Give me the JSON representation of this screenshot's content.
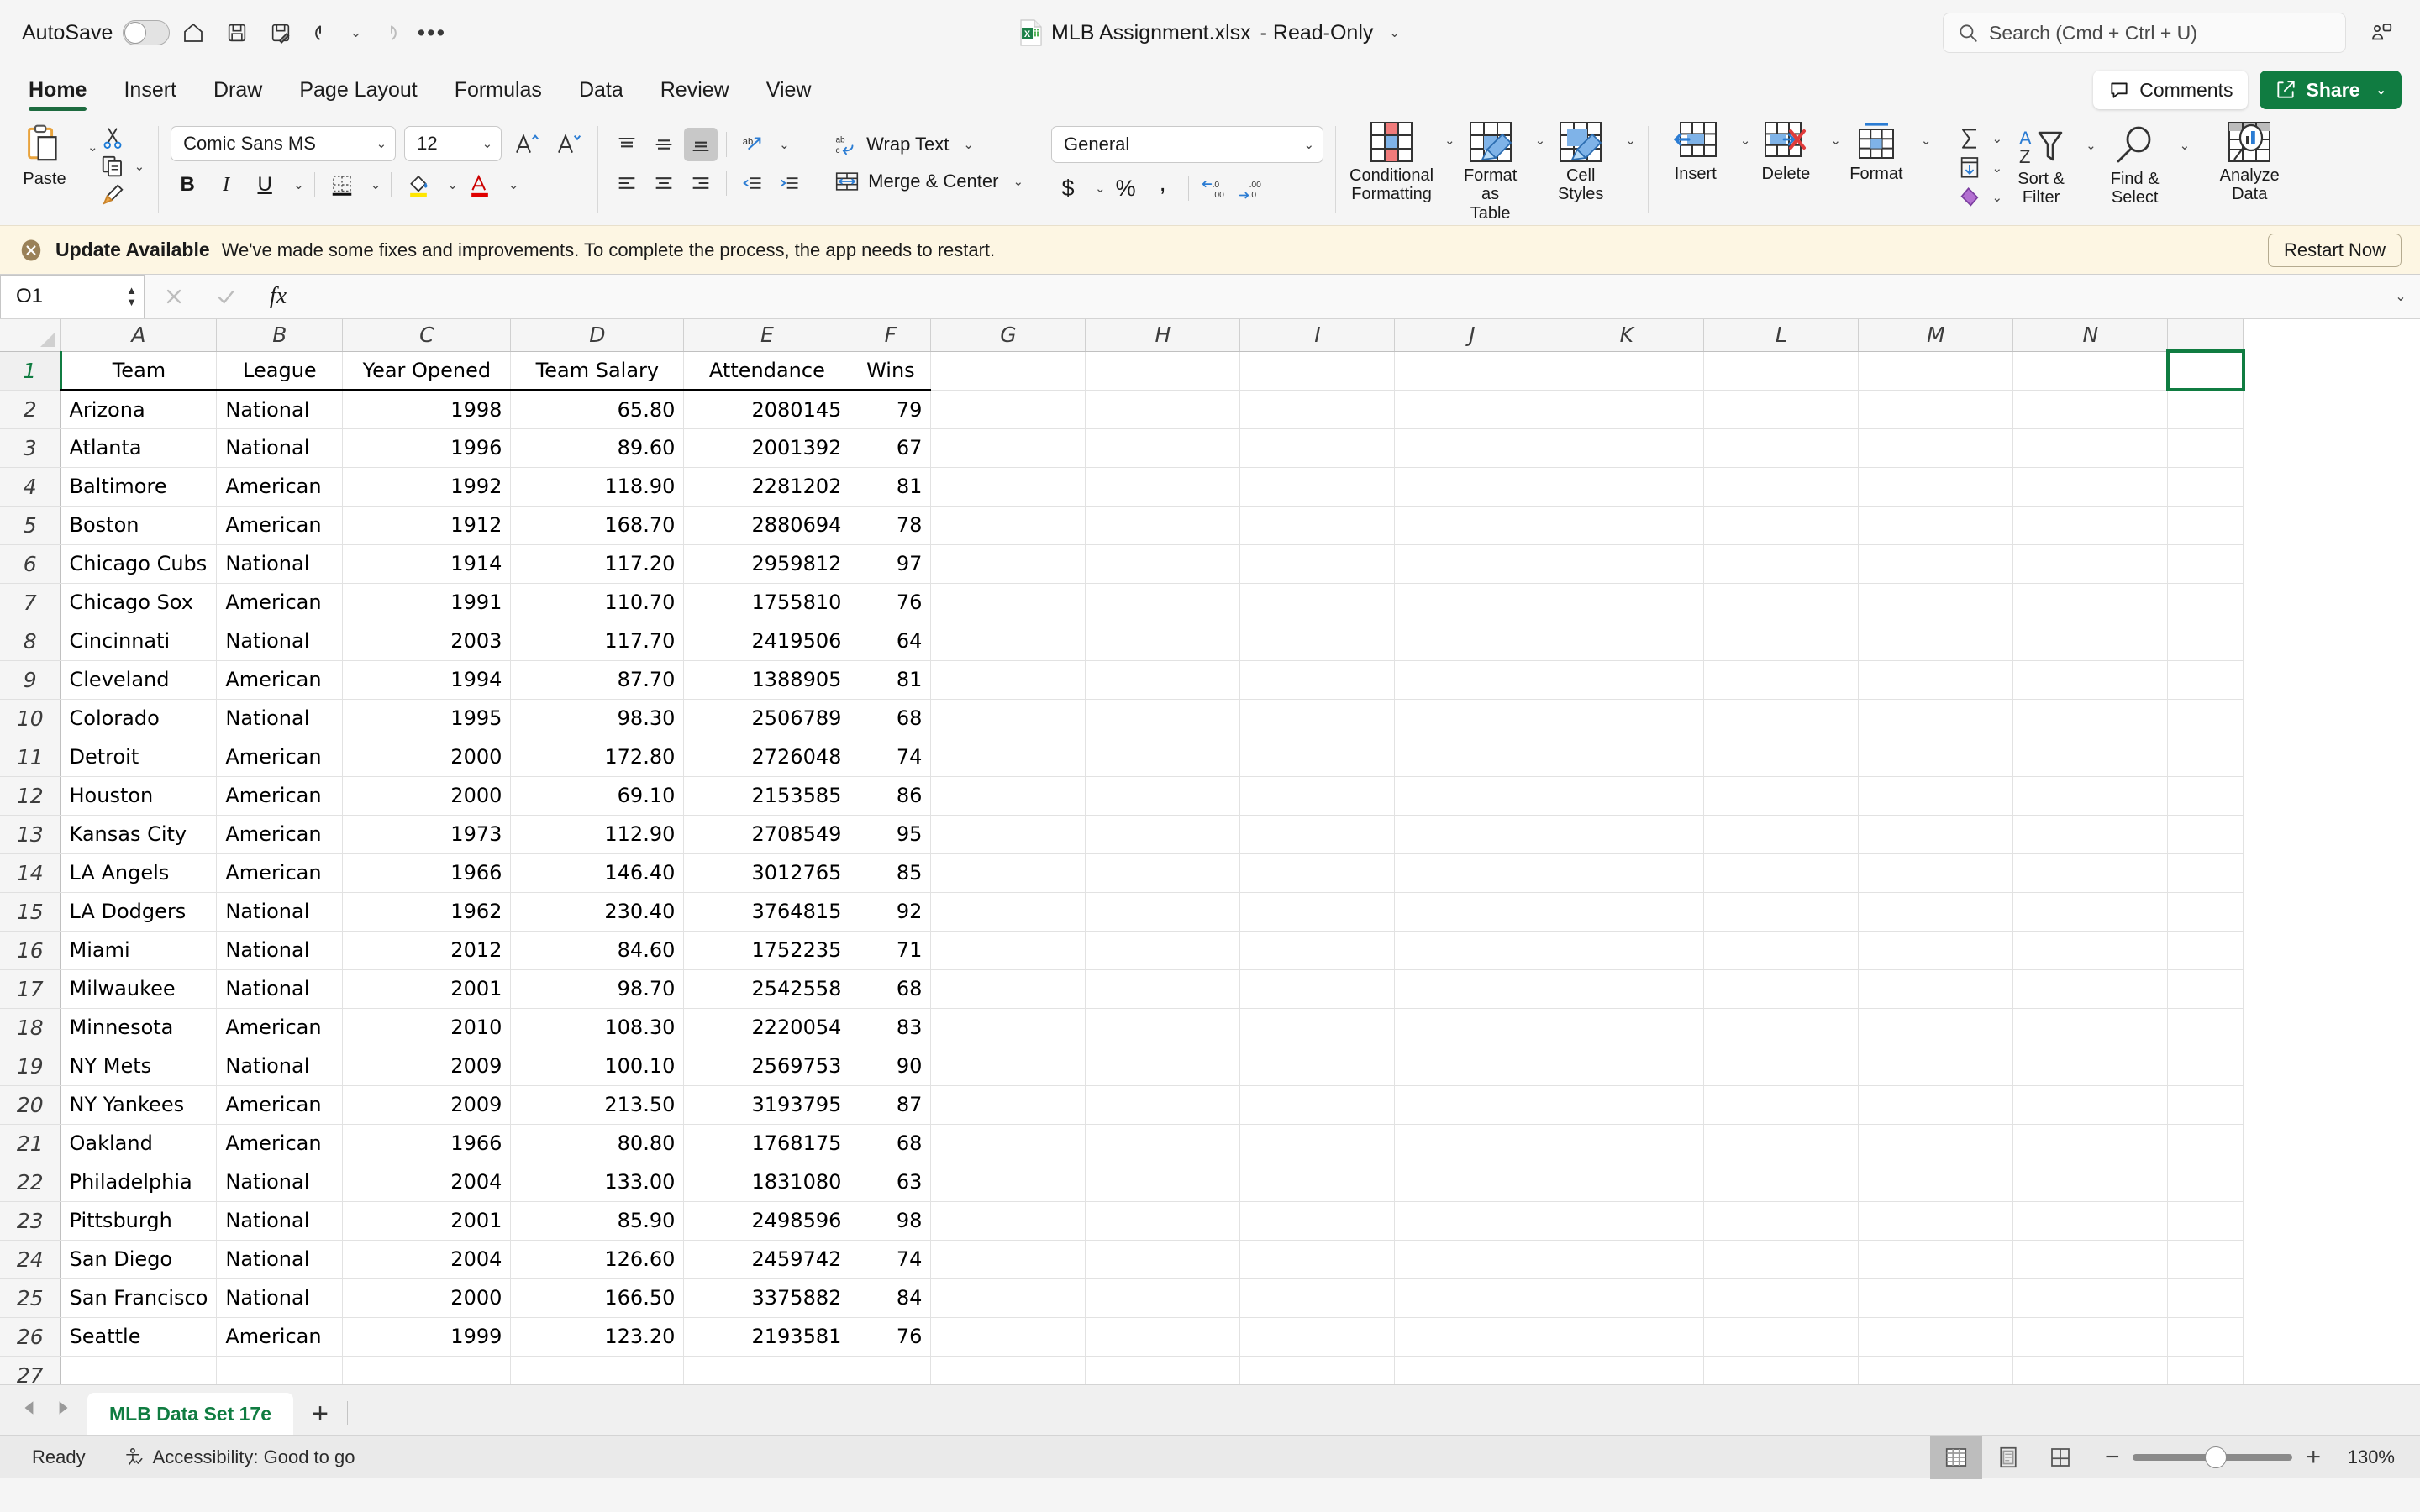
{
  "titlebar": {
    "autosave_label": "AutoSave",
    "document_name": "MLB Assignment.xlsx",
    "document_state": "-  Read-Only",
    "search_placeholder": "Search (Cmd + Ctrl + U)",
    "icons": {
      "home": "home-icon",
      "save": "save-icon",
      "save_as": "save-as-icon",
      "undo": "undo-icon",
      "redo": "redo-icon",
      "more": "more-options-icon",
      "ribbon_display": "ribbon-display-options-icon"
    }
  },
  "ribbon": {
    "tabs": [
      {
        "label": "Home",
        "active": true
      },
      {
        "label": "Insert",
        "active": false
      },
      {
        "label": "Draw",
        "active": false
      },
      {
        "label": "Page Layout",
        "active": false
      },
      {
        "label": "Formulas",
        "active": false
      },
      {
        "label": "Data",
        "active": false
      },
      {
        "label": "Review",
        "active": false
      },
      {
        "label": "View",
        "active": false
      }
    ],
    "comments_label": "Comments",
    "share_label": "Share",
    "clipboard": {
      "paste_label": "Paste",
      "cut": "cut-icon",
      "copy": "copy-icon",
      "format_painter": "format-painter-icon"
    },
    "font": {
      "family": "Comic Sans MS",
      "size": "12",
      "grow": "A",
      "shrink": "A",
      "bold": "B",
      "italic": "I",
      "underline": "U"
    },
    "alignment": {
      "wrap_text": "Wrap Text",
      "merge_center": "Merge & Center"
    },
    "number": {
      "format": "General",
      "currency": "$",
      "percent": "%",
      "comma": ",",
      "increase_decimal": ".00",
      "decrease_decimal": ".00"
    },
    "styles": [
      {
        "label_line1": "Conditional",
        "label_line2": "Formatting"
      },
      {
        "label_line1": "Format",
        "label_line2": "as Table"
      },
      {
        "label_line1": "Cell",
        "label_line2": "Styles"
      }
    ],
    "cells": [
      {
        "label": "Insert"
      },
      {
        "label": "Delete"
      },
      {
        "label": "Format"
      }
    ],
    "editing": [
      {
        "label_line1": "Sort &",
        "label_line2": "Filter"
      },
      {
        "label_line1": "Find &",
        "label_line2": "Select"
      }
    ],
    "analyze": {
      "label_line1": "Analyze",
      "label_line2": "Data"
    }
  },
  "banner": {
    "title": "Update Available",
    "message": "We've made some fixes and improvements. To complete the process, the app needs to restart.",
    "button": "Restart Now",
    "icon": "close-circle-icon"
  },
  "formula_bar": {
    "name_box": "O1",
    "cancel_icon": "cancel-icon",
    "confirm_icon": "confirm-icon",
    "function_icon": "fx",
    "value": ""
  },
  "sheet": {
    "columns": [
      "A",
      "B",
      "C",
      "D",
      "E",
      "F",
      "G",
      "H",
      "I",
      "J",
      "K",
      "L",
      "M",
      "N"
    ],
    "headers": [
      "Team",
      "League",
      "Year Opened",
      "Team Salary",
      "Attendance",
      "Wins"
    ],
    "selected_cell": "O1",
    "rows": [
      {
        "n": "2",
        "team": "Arizona",
        "league": "National",
        "year": "1998",
        "salary": "65.80",
        "attendance": "2080145",
        "wins": "79"
      },
      {
        "n": "3",
        "team": "Atlanta",
        "league": "National",
        "year": "1996",
        "salary": "89.60",
        "attendance": "2001392",
        "wins": "67"
      },
      {
        "n": "4",
        "team": "Baltimore",
        "league": "American",
        "year": "1992",
        "salary": "118.90",
        "attendance": "2281202",
        "wins": "81"
      },
      {
        "n": "5",
        "team": "Boston",
        "league": "American",
        "year": "1912",
        "salary": "168.70",
        "attendance": "2880694",
        "wins": "78"
      },
      {
        "n": "6",
        "team": "Chicago Cubs",
        "league": "National",
        "year": "1914",
        "salary": "117.20",
        "attendance": "2959812",
        "wins": "97"
      },
      {
        "n": "7",
        "team": "Chicago Sox",
        "league": "American",
        "year": "1991",
        "salary": "110.70",
        "attendance": "1755810",
        "wins": "76"
      },
      {
        "n": "8",
        "team": "Cincinnati",
        "league": "National",
        "year": "2003",
        "salary": "117.70",
        "attendance": "2419506",
        "wins": "64"
      },
      {
        "n": "9",
        "team": "Cleveland",
        "league": "American",
        "year": "1994",
        "salary": "87.70",
        "attendance": "1388905",
        "wins": "81"
      },
      {
        "n": "10",
        "team": "Colorado",
        "league": "National",
        "year": "1995",
        "salary": "98.30",
        "attendance": "2506789",
        "wins": "68"
      },
      {
        "n": "11",
        "team": "Detroit",
        "league": "American",
        "year": "2000",
        "salary": "172.80",
        "attendance": "2726048",
        "wins": "74"
      },
      {
        "n": "12",
        "team": "Houston",
        "league": "American",
        "year": "2000",
        "salary": "69.10",
        "attendance": "2153585",
        "wins": "86"
      },
      {
        "n": "13",
        "team": "Kansas City",
        "league": "American",
        "year": "1973",
        "salary": "112.90",
        "attendance": "2708549",
        "wins": "95"
      },
      {
        "n": "14",
        "team": "LA Angels",
        "league": "American",
        "year": "1966",
        "salary": "146.40",
        "attendance": "3012765",
        "wins": "85"
      },
      {
        "n": "15",
        "team": "LA Dodgers",
        "league": "National",
        "year": "1962",
        "salary": "230.40",
        "attendance": "3764815",
        "wins": "92"
      },
      {
        "n": "16",
        "team": "Miami",
        "league": "National",
        "year": "2012",
        "salary": "84.60",
        "attendance": "1752235",
        "wins": "71"
      },
      {
        "n": "17",
        "team": "Milwaukee",
        "league": "National",
        "year": "2001",
        "salary": "98.70",
        "attendance": "2542558",
        "wins": "68"
      },
      {
        "n": "18",
        "team": "Minnesota",
        "league": "American",
        "year": "2010",
        "salary": "108.30",
        "attendance": "2220054",
        "wins": "83"
      },
      {
        "n": "19",
        "team": "NY Mets",
        "league": "National",
        "year": "2009",
        "salary": "100.10",
        "attendance": "2569753",
        "wins": "90"
      },
      {
        "n": "20",
        "team": "NY Yankees",
        "league": "American",
        "year": "2009",
        "salary": "213.50",
        "attendance": "3193795",
        "wins": "87"
      },
      {
        "n": "21",
        "team": "Oakland",
        "league": "American",
        "year": "1966",
        "salary": "80.80",
        "attendance": "1768175",
        "wins": "68"
      },
      {
        "n": "22",
        "team": "Philadelphia",
        "league": "National",
        "year": "2004",
        "salary": "133.00",
        "attendance": "1831080",
        "wins": "63"
      },
      {
        "n": "23",
        "team": "Pittsburgh",
        "league": "National",
        "year": "2001",
        "salary": "85.90",
        "attendance": "2498596",
        "wins": "98"
      },
      {
        "n": "24",
        "team": "San Diego",
        "league": "National",
        "year": "2004",
        "salary": "126.60",
        "attendance": "2459742",
        "wins": "74"
      },
      {
        "n": "25",
        "team": "San Francisco",
        "league": "National",
        "year": "2000",
        "salary": "166.50",
        "attendance": "3375882",
        "wins": "84"
      },
      {
        "n": "26",
        "team": "Seattle",
        "league": "American",
        "year": "1999",
        "salary": "123.20",
        "attendance": "2193581",
        "wins": "76"
      },
      {
        "n": "27",
        "team": "",
        "league": "",
        "year": "",
        "salary": "",
        "attendance": "",
        "wins": ""
      }
    ]
  },
  "sheet_tabs": {
    "active": "MLB Data Set 17e",
    "add_label": "+"
  },
  "statusbar": {
    "state": "Ready",
    "accessibility": "Accessibility: Good to go",
    "zoom": "130%",
    "views": [
      "normal-view-icon",
      "page-layout-view-icon",
      "page-break-view-icon"
    ]
  },
  "colors": {
    "accent_green": "#107c41",
    "banner_bg": "#fdf6e3",
    "ribbon_bg": "#f5f5f5"
  }
}
